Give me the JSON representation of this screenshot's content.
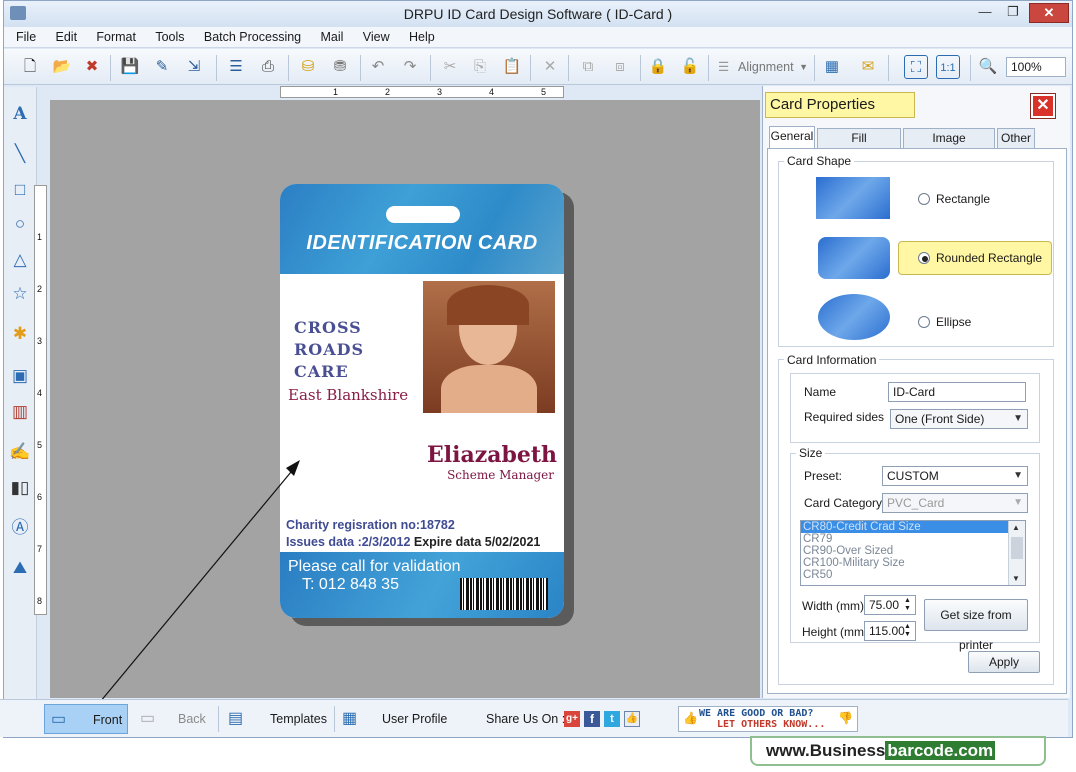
{
  "window": {
    "title": "DRPU ID Card Design Software ( ID-Card )",
    "min": "—",
    "restore": "❐",
    "close": "✕"
  },
  "menu": [
    "File",
    "Edit",
    "Format",
    "Tools",
    "Batch Processing",
    "Mail",
    "View",
    "Help"
  ],
  "toolbar": {
    "alignment_label": "Alignment",
    "zoom_value": "100%"
  },
  "rulers": {
    "h": [
      "1",
      "2",
      "3",
      "4",
      "5"
    ],
    "v": [
      "1",
      "2",
      "3",
      "4",
      "5",
      "6",
      "7",
      "8"
    ]
  },
  "card": {
    "title": "IDENTIFICATION CARD",
    "org_lines": [
      "CROSS",
      "ROADS",
      "CARE"
    ],
    "org_city": "East Blankshire",
    "name": "Eliazabeth",
    "role": "Scheme Manager",
    "charity": "Charity regisration no:18782",
    "issue_prefix": "Issues data :",
    "issue_date": "2/3/2012",
    "expire": " Expire data 5/02/2021",
    "call_line1": "Please call for validation",
    "call_line2": "T: 012 848 35"
  },
  "props": {
    "title": "Card Properties",
    "tabs": [
      "General",
      "Fill Background",
      "Image Processing",
      "Other"
    ],
    "card_shape_label": "Card Shape",
    "shapes": [
      "Rectangle",
      "Rounded Rectangle",
      "Ellipse"
    ],
    "card_info_label": "Card Information",
    "name_label": "Name",
    "name_value": "ID-Card",
    "sides_label": "Required sides",
    "sides_value": "One (Front Side)",
    "size_label": "Size",
    "preset_label": "Preset:",
    "preset_value": "CUSTOM",
    "category_label": "Card Category",
    "category_value": "PVC_Card",
    "size_list": [
      "CR80-Credit Crad Size",
      "CR79",
      "CR90-Over Sized",
      "CR100-Military Size",
      "CR50"
    ],
    "width_label": "Width  (mm)",
    "width_value": "75.00",
    "height_label": "Height (mm)",
    "height_value": "115.00",
    "printer_button": "Get size from printer",
    "apply_button": "Apply"
  },
  "bottom": {
    "front": "Front",
    "back": "Back",
    "templates": "Templates",
    "user_profile": "User Profile",
    "share": "Share Us On :",
    "feedback1": "WE ARE GOOD OR BAD?",
    "feedback2": "LET OTHERS KNOW..."
  },
  "watermark": {
    "part1": "www.Business",
    "part2": "barcode.com"
  },
  "colors": {
    "accent": "#2e8bc9",
    "name_color": "#7d1543",
    "org_color": "#4a4f93",
    "highlight": "#fff7a3"
  }
}
